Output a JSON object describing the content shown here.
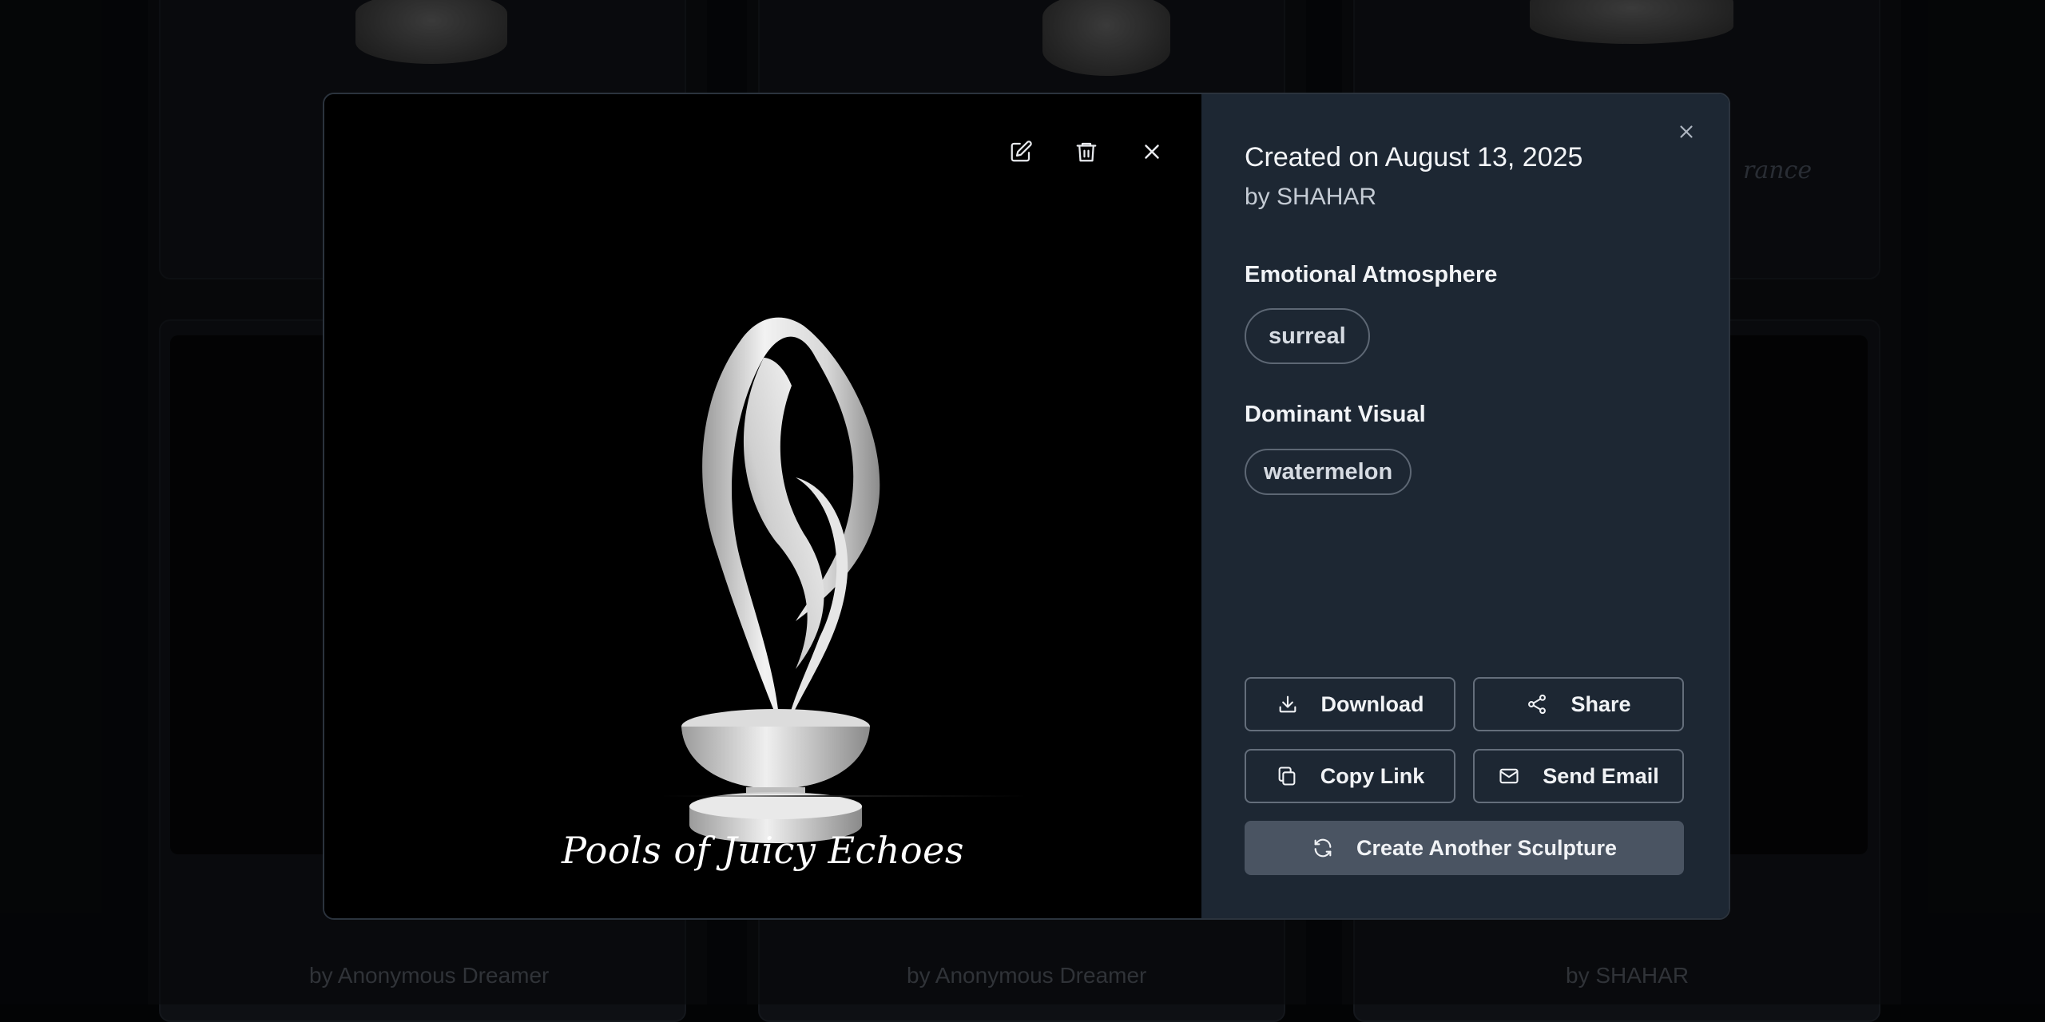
{
  "gallery": {
    "cards": [
      {
        "byline": "by Anonymous Dreamer"
      },
      {
        "byline": "by Anonymous Dreamer"
      },
      {
        "byline": "by SHAHAR"
      }
    ],
    "peek_title_fragment": "rance"
  },
  "viewer": {
    "title": "Pools of Juicy Echoes",
    "tools": {
      "edit_icon": "edit-icon",
      "delete_icon": "trash-icon",
      "close_icon": "close-icon"
    }
  },
  "details": {
    "created": "Created on August 13, 2025",
    "byline": "by SHAHAR",
    "emotional_atmosphere": {
      "heading": "Emotional Atmosphere",
      "tag": "surreal"
    },
    "dominant_visual": {
      "heading": "Dominant Visual",
      "tag": "watermelon"
    },
    "actions": {
      "download": "Download",
      "share": "Share",
      "copy_link": "Copy Link",
      "send_email": "Send Email",
      "create_another": "Create Another Sculpture"
    }
  },
  "colors": {
    "panel_bg": "#1d2733",
    "viewer_bg": "#000000",
    "primary_button": "#4a5462",
    "tag_border": "#5d6774"
  }
}
